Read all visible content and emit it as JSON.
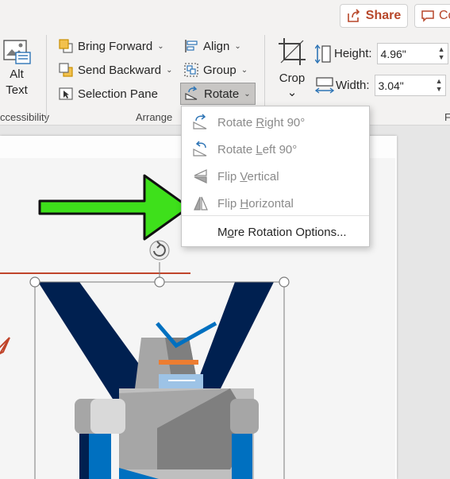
{
  "header": {
    "share_label": "Share",
    "comments_label": "Co"
  },
  "ribbon": {
    "alt_text_line1": "Alt",
    "alt_text_line2": "Text",
    "accessibility_group": "ccessibility",
    "bring_forward": "Bring Forward",
    "send_backward": "Send Backward",
    "selection_pane": "Selection Pane",
    "arrange_group": "Arrange",
    "align": "Align",
    "group": "Group",
    "rotate": "Rotate",
    "crop": "Crop",
    "height_label": "Height:",
    "height_value": "4.96\"",
    "width_label": "Width:",
    "width_value": "3.04\"",
    "size_group_partial": "F"
  },
  "rotate_menu": {
    "items": [
      {
        "pre": "Rotate ",
        "key": "R",
        "post": "ight 90°",
        "icon": "rotate-right-icon"
      },
      {
        "pre": "Rotate ",
        "key": "L",
        "post": "eft 90°",
        "icon": "rotate-left-icon"
      },
      {
        "pre": "Flip ",
        "key": "V",
        "post": "ertical",
        "icon": "flip-vertical-icon"
      },
      {
        "pre": "Flip ",
        "key": "H",
        "post": "orizontal",
        "icon": "flip-horizontal-icon"
      }
    ],
    "more_pre": "M",
    "more_key": "o",
    "more_post": "re Rotation Options..."
  },
  "colors": {
    "accent": "#b7472a",
    "rotate_icon_blue": "#2e75b6",
    "arrow_green": "#3ee01b",
    "robot_navy": "#002050",
    "robot_blue": "#0070c0"
  }
}
